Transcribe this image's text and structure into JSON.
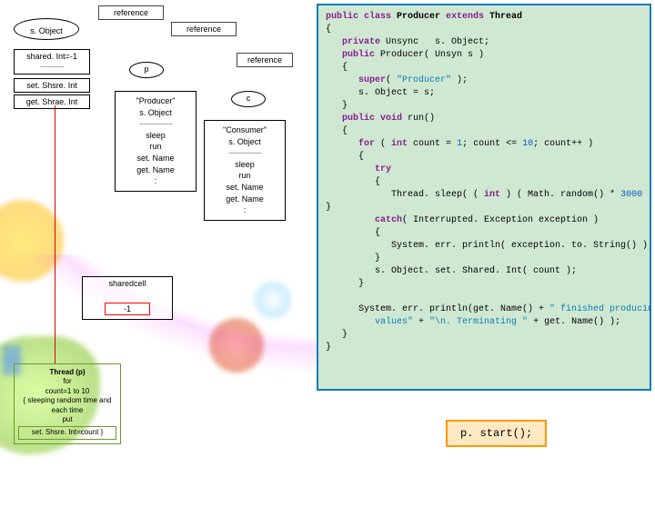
{
  "labels": {
    "reference1": "reference",
    "reference2": "reference",
    "reference3": "reference",
    "sObject": "s. Object",
    "sharedInt_box": "shared. Int=-1",
    "dots": "-------------",
    "setShsreInt": "set. Shsre. Int",
    "getShraeInt": "get. Shrae. Int"
  },
  "p_obj": {
    "var": "p",
    "name": "\"Producer\"",
    "sobj": "s. Object",
    "sep": "------------------",
    "m1": "sleep",
    "m2": "run",
    "m3": "set. Name",
    "m4": "get. Name",
    "colon": ":"
  },
  "c_obj": {
    "var": "c",
    "name": "\"Consumer\"",
    "sobj": "s. Object",
    "sep": "------------------",
    "m1": "sleep",
    "m2": "run",
    "m3": "set. Name",
    "m4": "get. Name",
    "colon": ":"
  },
  "sharedcell": {
    "label": "sharedcell",
    "value": "-1"
  },
  "threadp": {
    "l1": "Thread (p)",
    "l2": "for",
    "l3": "count=1 to 10",
    "l4": "{   sleeping random time and each time",
    "l5": "put",
    "l6": "set. Shsre. Int=count }"
  },
  "code": {
    "l1_a": "public class ",
    "l1_b": "Producer ",
    "l1_c": "extends ",
    "l1_d": "Thread",
    "l2": "{",
    "l3_a": "   private ",
    "l3_b": "Unsync   s. Object;",
    "l4_a": "   public ",
    "l4_b": "Producer( Unsyn s )",
    "l5": "   {",
    "l6_a": "      super",
    "l6_b": "( ",
    "l6_c": "\"Producer\"",
    "l6_d": " );",
    "l7": "      s. Object = s;",
    "l8": "   }",
    "l9_a": "   public void ",
    "l9_b": "run()",
    "l10": "   {",
    "l11_a": "      for ",
    "l11_b": "( ",
    "l11_c": "int ",
    "l11_d": "count = ",
    "l11_e": "1",
    "l11_f": "; count <= ",
    "l11_g": "10",
    "l11_h": "; count++ )",
    "l12": "      {",
    "l13_a": "         try",
    "l14": "         {",
    "l15_a": "            Thread. sleep( ( ",
    "l15_b": "int ",
    "l15_c": ") ( Math. random() * ",
    "l15_d": "3000",
    "l15_e": " ) ) );",
    "l16": "}",
    "l17_a": "         catch",
    "l17_b": "( Interrupted. Exception exception )",
    "l18": "         {",
    "l19": "            System. err. println( exception. to. String() );",
    "l20": "         }",
    "l21": "         s. Object. set. Shared. Int( count );",
    "l22": "      }",
    "blank": "",
    "l23a": "      System. err. println(get. Name() + ",
    "l23b": "\" finished producing",
    "l24a": "         values\"",
    "l24b": " + ",
    "l24c": "\"\\n. Terminating \"",
    "l24d": " + get. Name() );",
    "l25": "   }",
    "l26": "}"
  },
  "start": "p. start();"
}
